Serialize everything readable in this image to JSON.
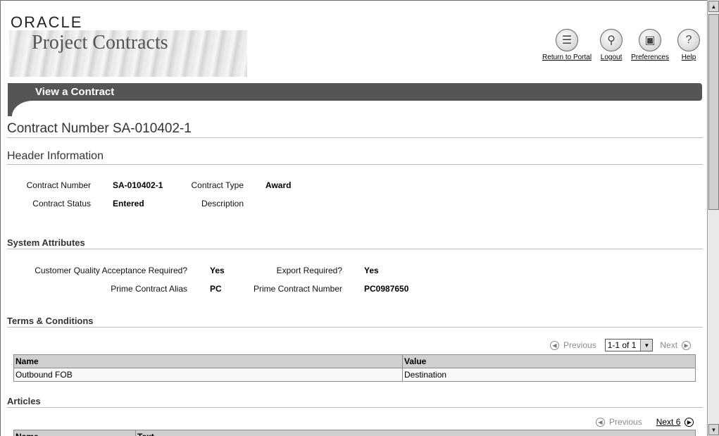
{
  "brand": {
    "company": "ORACLE",
    "product": "Project Contracts"
  },
  "global_nav": [
    {
      "id": "return-to-portal",
      "label": "Return to Portal",
      "icon": "portal-icon"
    },
    {
      "id": "logout",
      "label": "Logout",
      "icon": "logout-icon"
    },
    {
      "id": "preferences",
      "label": "Preferences",
      "icon": "preferences-icon"
    },
    {
      "id": "help",
      "label": "Help",
      "icon": "help-icon"
    }
  ],
  "page": {
    "heading": "View a Contract",
    "title": "Contract Number SA-010402-1"
  },
  "header_info": {
    "section_title": "Header Information",
    "contract_number_label": "Contract Number",
    "contract_number": "SA-010402-1",
    "contract_type_label": "Contract Type",
    "contract_type": "Award",
    "contract_status_label": "Contract Status",
    "contract_status": "Entered",
    "description_label": "Description",
    "description": ""
  },
  "system_attributes": {
    "section_title": "System Attributes",
    "cqa_label": "Customer Quality Acceptance Required?",
    "cqa": "Yes",
    "export_label": "Export Required?",
    "export": "Yes",
    "alias_label": "Prime Contract Alias",
    "alias": "PC",
    "prime_number_label": "Prime Contract Number",
    "prime_number": "PC0987650"
  },
  "terms": {
    "section_title": "Terms & Conditions",
    "nav": {
      "previous": "Previous",
      "range": "1-1 of 1",
      "next": "Next"
    },
    "columns": [
      "Name",
      "Value"
    ],
    "rows": [
      {
        "name": "Outbound FOB",
        "value": "Destination"
      }
    ]
  },
  "articles": {
    "section_title": "Articles",
    "nav": {
      "previous": "Previous",
      "next": "Next 6"
    },
    "columns": [
      "Name",
      "Text"
    ]
  }
}
